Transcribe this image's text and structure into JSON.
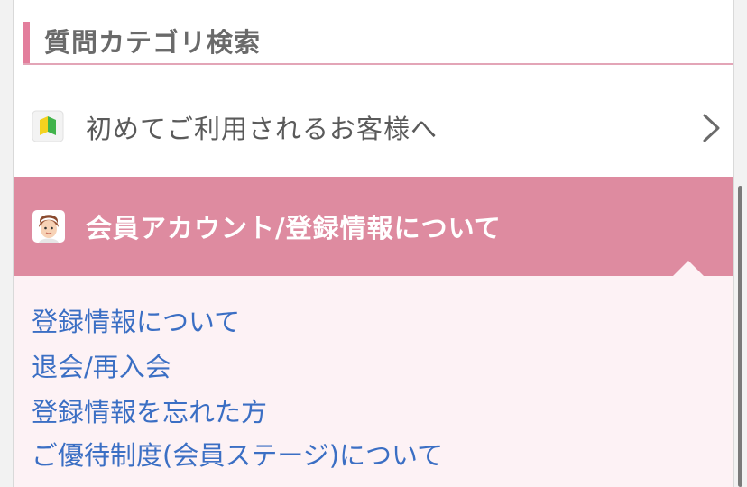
{
  "section": {
    "title": "質問カテゴリ検索"
  },
  "categories": [
    {
      "label": "初めてご利用されるお客様へ",
      "icon": "beginner-mark-icon",
      "expanded": false
    },
    {
      "label": "会員アカウント/登録情報について",
      "icon": "member-face-icon",
      "expanded": true
    }
  ],
  "subitems": [
    "登録情報について",
    "退会/再入会",
    "登録情報を忘れた方",
    "ご優待制度(会員ステージ)について"
  ],
  "colors": {
    "accent": "#e37e9c",
    "active_background": "#de8ba0",
    "subitem_background": "#fdf2f5",
    "link": "#3b6fc4",
    "title_text": "#6a6a6a"
  }
}
